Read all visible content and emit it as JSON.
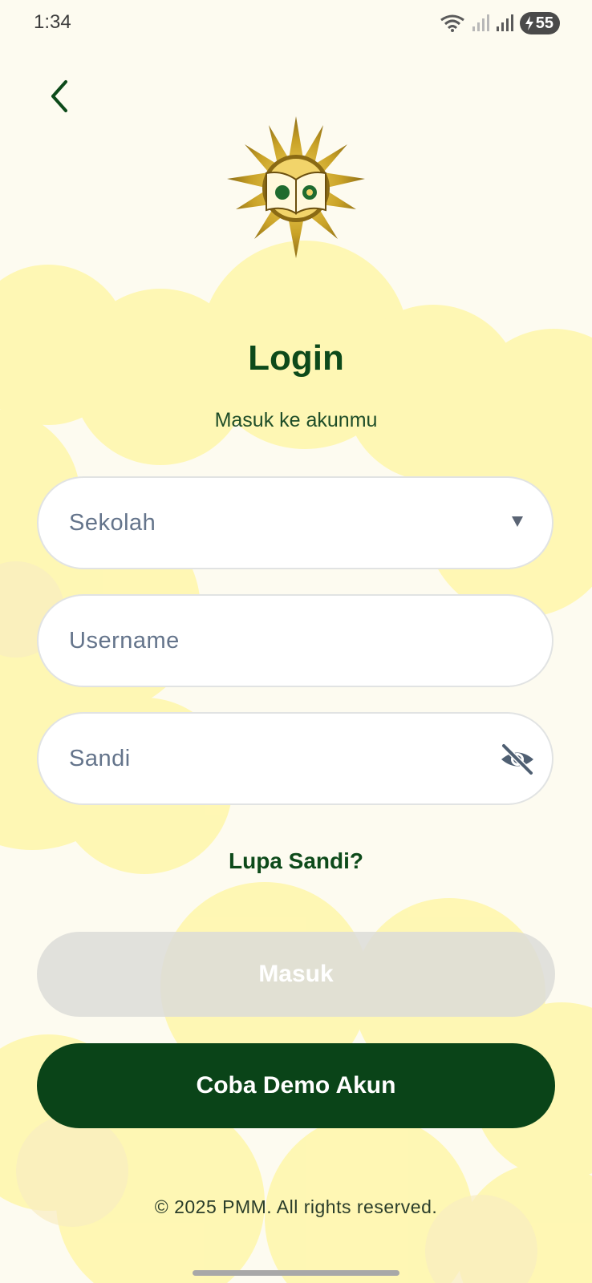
{
  "status_bar": {
    "time": "1:34",
    "battery_level": "55",
    "icons": [
      "wifi-icon",
      "signal-icon",
      "signal-icon",
      "battery-charging-icon"
    ]
  },
  "nav": {
    "back_icon": "chevron-left-icon"
  },
  "header": {
    "title": "Login",
    "subtitle": "Masuk ke akunmu"
  },
  "form": {
    "school_select": {
      "placeholder": "Sekolah",
      "icon": "dropdown-arrow-icon"
    },
    "username": {
      "placeholder": "Username"
    },
    "password": {
      "placeholder": "Sandi",
      "icon": "eye-off-icon"
    },
    "forgot_label": "Lupa Sandi?",
    "submit_label": "Masuk",
    "demo_label": "Coba Demo Akun"
  },
  "footer": {
    "copyright": "© 2025 PMM. All rights reserved."
  },
  "colors": {
    "background": "#fdfbf0",
    "cloud": "#fff8a8",
    "primary_green": "#0a4418",
    "heading_green": "#0d4a1a",
    "placeholder_gray": "#64748b",
    "disabled_button": "#dcdcd8",
    "logo_gold": "#c9a227"
  }
}
